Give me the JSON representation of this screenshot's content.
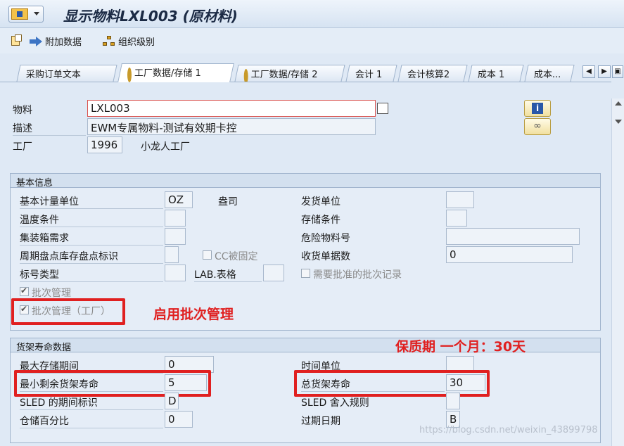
{
  "window": {
    "title": "显示物料LXL003 (原材料)"
  },
  "toolbar": {
    "additional_data": "附加数据",
    "org_levels": "组织级别"
  },
  "tabs": [
    {
      "label": "采购订单文本"
    },
    {
      "label": "工厂数据/存储 1"
    },
    {
      "label": "工厂数据/存储 2"
    },
    {
      "label": "会计 1"
    },
    {
      "label": "会计核算2"
    },
    {
      "label": "成本 1"
    },
    {
      "label": "成本..."
    }
  ],
  "header": {
    "material_label": "物料",
    "material_value": "LXL003",
    "desc_label": "描述",
    "desc_value": "EWM专属物料-测试有效期卡控",
    "plant_label": "工厂",
    "plant_value": "1996",
    "plant_name": "小龙人工厂"
  },
  "basic": {
    "title": "基本信息",
    "base_uom_label": "基本计量单位",
    "base_uom_value": "OZ",
    "base_uom_text": "盎司",
    "issue_unit_label": "发货单位",
    "temp_label": "温度条件",
    "storage_label": "存储条件",
    "container_label": "集装箱需求",
    "hazmat_label": "危险物料号",
    "cycle_label": "周期盘点库存盘点标识",
    "cc_fixed_label": "CC被固定",
    "gr_slips_label": "收货单据数",
    "gr_slips_value": "0",
    "label_type_label": "标号类型",
    "lab_form_label": "LAB.表格",
    "approved_batch_label": "需要批准的批次记录",
    "batch_mgmt_label": "批次管理",
    "batch_mgmt_plant_label": "批次管理（工厂）"
  },
  "shelf": {
    "title": "货架寿命数据",
    "max_storage_label": "最大存储期间",
    "max_storage_value": "0",
    "time_unit_label": "时间单位",
    "min_rem_label": "最小剩余货架寿命",
    "min_rem_value": "5",
    "total_label": "总货架寿命",
    "total_value": "30",
    "sled_period_label": "SLED 的期间标识",
    "sled_period_value": "D",
    "sled_round_label": "SLED 舍入规则",
    "storage_pct_label": "仓储百分比",
    "storage_pct_value": "0",
    "expiry_label": "过期日期",
    "expiry_value": "B"
  },
  "annotations": {
    "batch": "启用批次管理",
    "shelf": "保质期 一个月：30天"
  },
  "watermark": "https://blog.csdn.net/weixin_43899798",
  "icons": [
    "app-menu-icon",
    "additional-data-icon",
    "arrow-icon",
    "org-levels-icon",
    "gear-icon",
    "info-icon",
    "glasses-icon",
    "copy-icon"
  ]
}
